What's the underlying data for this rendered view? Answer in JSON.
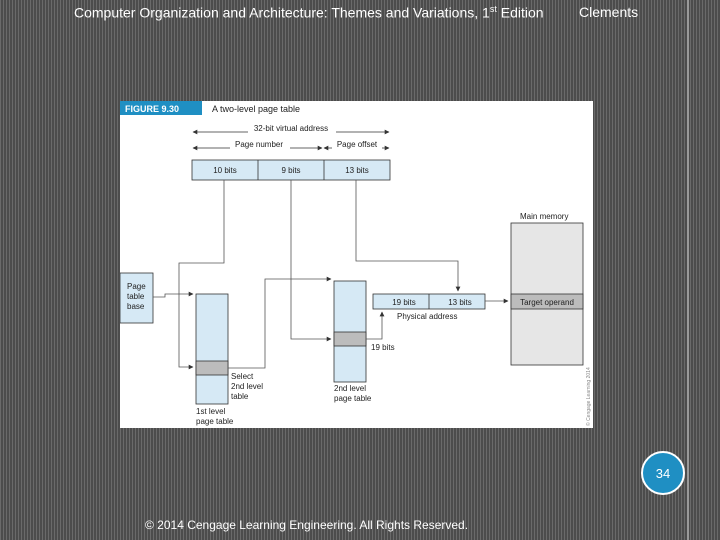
{
  "header": {
    "title": "Computer Organization and Architecture: Themes and Variations, 1",
    "title_sup": "st",
    "title_end": " Edition",
    "author": "Clements"
  },
  "figure": {
    "label": "FIGURE 9.30",
    "caption": "A two-level page table",
    "virtual_address_label": "32-bit virtual address",
    "page_number_label": "Page number",
    "page_offset_label": "Page offset",
    "fields": [
      "10 bits",
      "9 bits",
      "13 bits"
    ],
    "page_table_base_label": [
      "Page",
      "table",
      "base"
    ],
    "first_level_label": [
      "1st level",
      "page table"
    ],
    "select_label": [
      "Select",
      "2nd level",
      "table"
    ],
    "second_level_label": [
      "2nd level",
      "page table"
    ],
    "physical_fields": [
      "19 bits",
      "13 bits"
    ],
    "physical_address_label": "Physical address",
    "nineteen_bits_label": "19 bits",
    "main_memory_label": "Main memory",
    "target_operand_label": "Target operand",
    "watermark": "© Cengage Learning 2014"
  },
  "footer": {
    "slide_number": "34",
    "copyright": "© 2014 Cengage Learning Engineering. All Rights Reserved."
  },
  "colors": {
    "figure_accent": "#1f8fc3",
    "box_fill": "#d6e9f5",
    "memory_fill": "#e6e6e6",
    "band_fill": "#bcbcbc",
    "slide_number_bg": "#1f8fc3"
  }
}
